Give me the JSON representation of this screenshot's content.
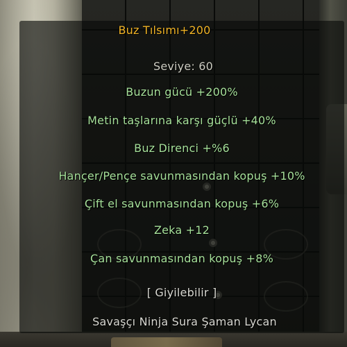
{
  "item": {
    "title": "Buz Tılsımı+200",
    "level": "Seviye: 60",
    "bonuses": [
      "Buzun gücü +200%",
      "Metin taşlarına karşı güçlü +40%",
      "Buz Direnci +%6",
      "Hançer/Pençe savunmasından kopuş +10%",
      "Çift el savunmasından kopuş +6%",
      "Zeka +12",
      "Çan savunmasından kopuş +8%"
    ],
    "wearable": "[ Giyilebilir ]",
    "classes": "Savaşçı Ninja Sura Şaman Lycan"
  },
  "colors": {
    "title": "#f1b427",
    "level": "#cfcfc4",
    "bonus": "#a6e09a",
    "info": "#d9d9d2"
  }
}
